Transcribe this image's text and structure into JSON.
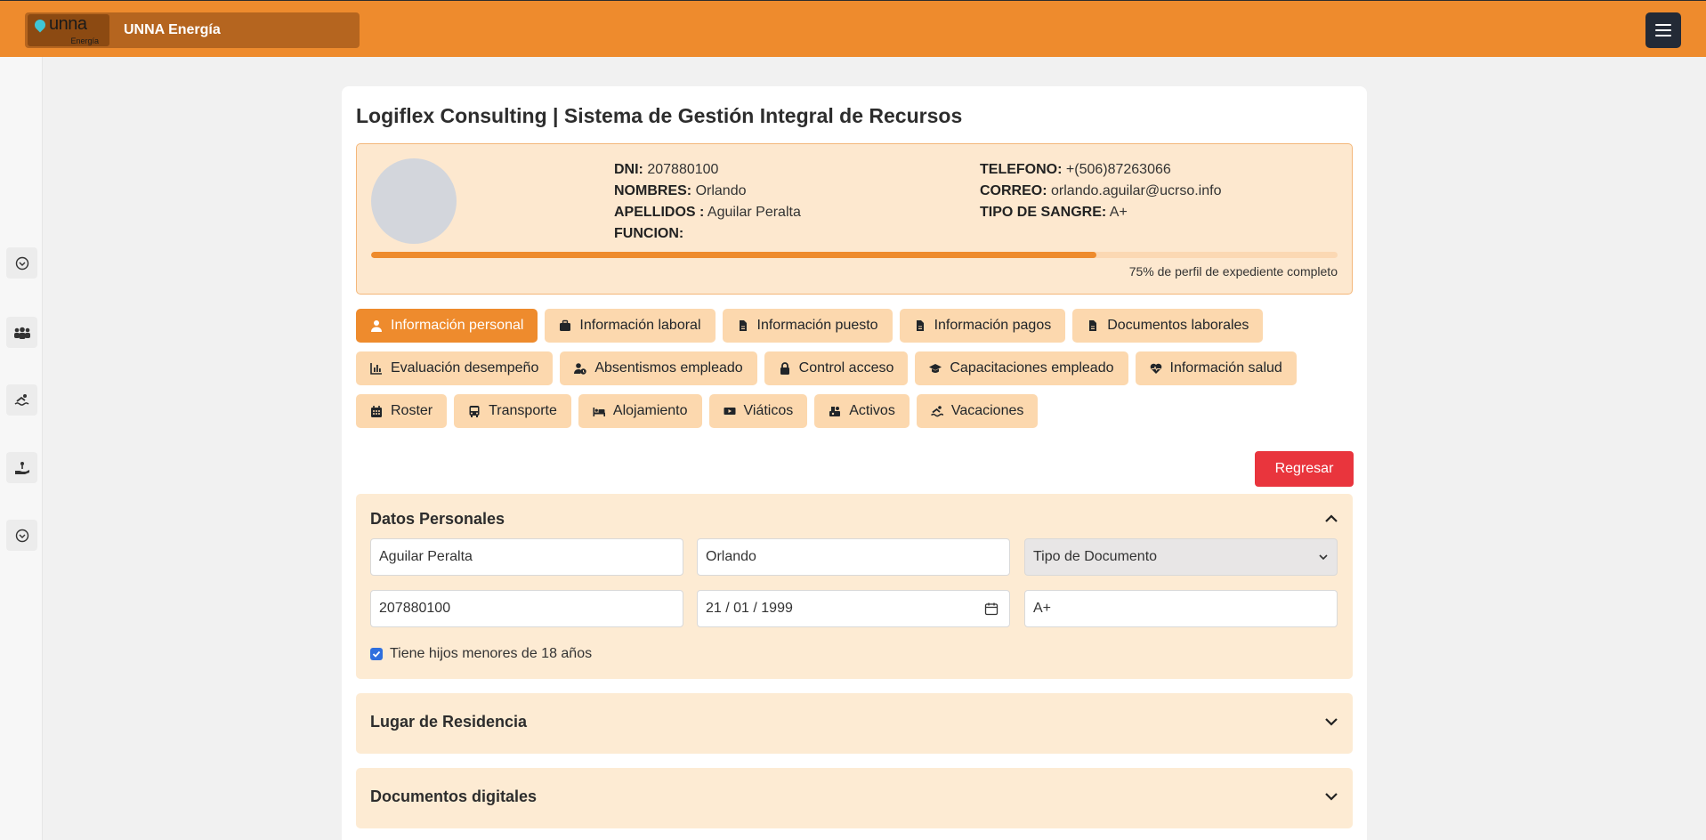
{
  "header": {
    "brand_title": "UNNA Energía",
    "logo_word": "unna",
    "logo_sub": "Energía"
  },
  "page": {
    "title": "Logiflex Consulting | Sistema de Gestión Integral de Recursos"
  },
  "profile": {
    "dni_label": "DNI:",
    "dni": "207880100",
    "nombres_label": "NOMBRES:",
    "nombres": "Orlando",
    "apellidos_label": "APELLIDOS :",
    "apellidos": "Aguilar Peralta",
    "funcion_label": "FUNCION:",
    "funcion": "",
    "telefono_label": "TELEFONO:",
    "telefono": "+(506)87263066",
    "correo_label": "CORREO:",
    "correo": "orlando.aguilar@ucrso.info",
    "sangre_label": "TIPO DE SANGRE:",
    "sangre": "A+",
    "progress_percent": 75,
    "progress_text": "75% de perfil de expediente completo"
  },
  "tabs": [
    {
      "label": "Información personal",
      "icon": "user-icon",
      "active": true
    },
    {
      "label": "Información laboral",
      "icon": "briefcase-icon"
    },
    {
      "label": "Información puesto",
      "icon": "file-icon"
    },
    {
      "label": "Información pagos",
      "icon": "file-icon"
    },
    {
      "label": "Documentos laborales",
      "icon": "file-icon"
    },
    {
      "label": "Evaluación desempeño",
      "icon": "chart-icon"
    },
    {
      "label": "Absentismos empleado",
      "icon": "user-clock-icon"
    },
    {
      "label": "Control acceso",
      "icon": "lock-icon"
    },
    {
      "label": "Capacitaciones empleado",
      "icon": "graduation-cap-icon"
    },
    {
      "label": "Información salud",
      "icon": "heart-pulse-icon"
    },
    {
      "label": "Roster",
      "icon": "calendar-icon"
    },
    {
      "label": "Transporte",
      "icon": "bus-icon"
    },
    {
      "label": "Alojamiento",
      "icon": "bed-icon"
    },
    {
      "label": "Viáticos",
      "icon": "money-icon"
    },
    {
      "label": "Activos",
      "icon": "assets-icon"
    },
    {
      "label": "Vacaciones",
      "icon": "swimmer-icon"
    }
  ],
  "actions": {
    "back_label": "Regresar"
  },
  "datos_personales": {
    "title": "Datos Personales",
    "apellidos_value": "Aguilar Peralta",
    "nombres_value": "Orlando",
    "tipo_documento_selected": "Tipo de Documento",
    "dni_value": "207880100",
    "fecha_nacimiento_value": "21 / 01 / 1999",
    "tipo_sangre_value": "A+",
    "hijos_label": "Tiene hijos menores de 18 años",
    "hijos_checked": true
  },
  "sections": {
    "residencia_title": "Lugar de Residencia",
    "documentos_title": "Documentos digitales"
  },
  "colors": {
    "accent": "#ee8b2d",
    "tab_bg": "#fcd8ae",
    "danger": "#e9353d",
    "section_bg": "#fdebd3"
  }
}
